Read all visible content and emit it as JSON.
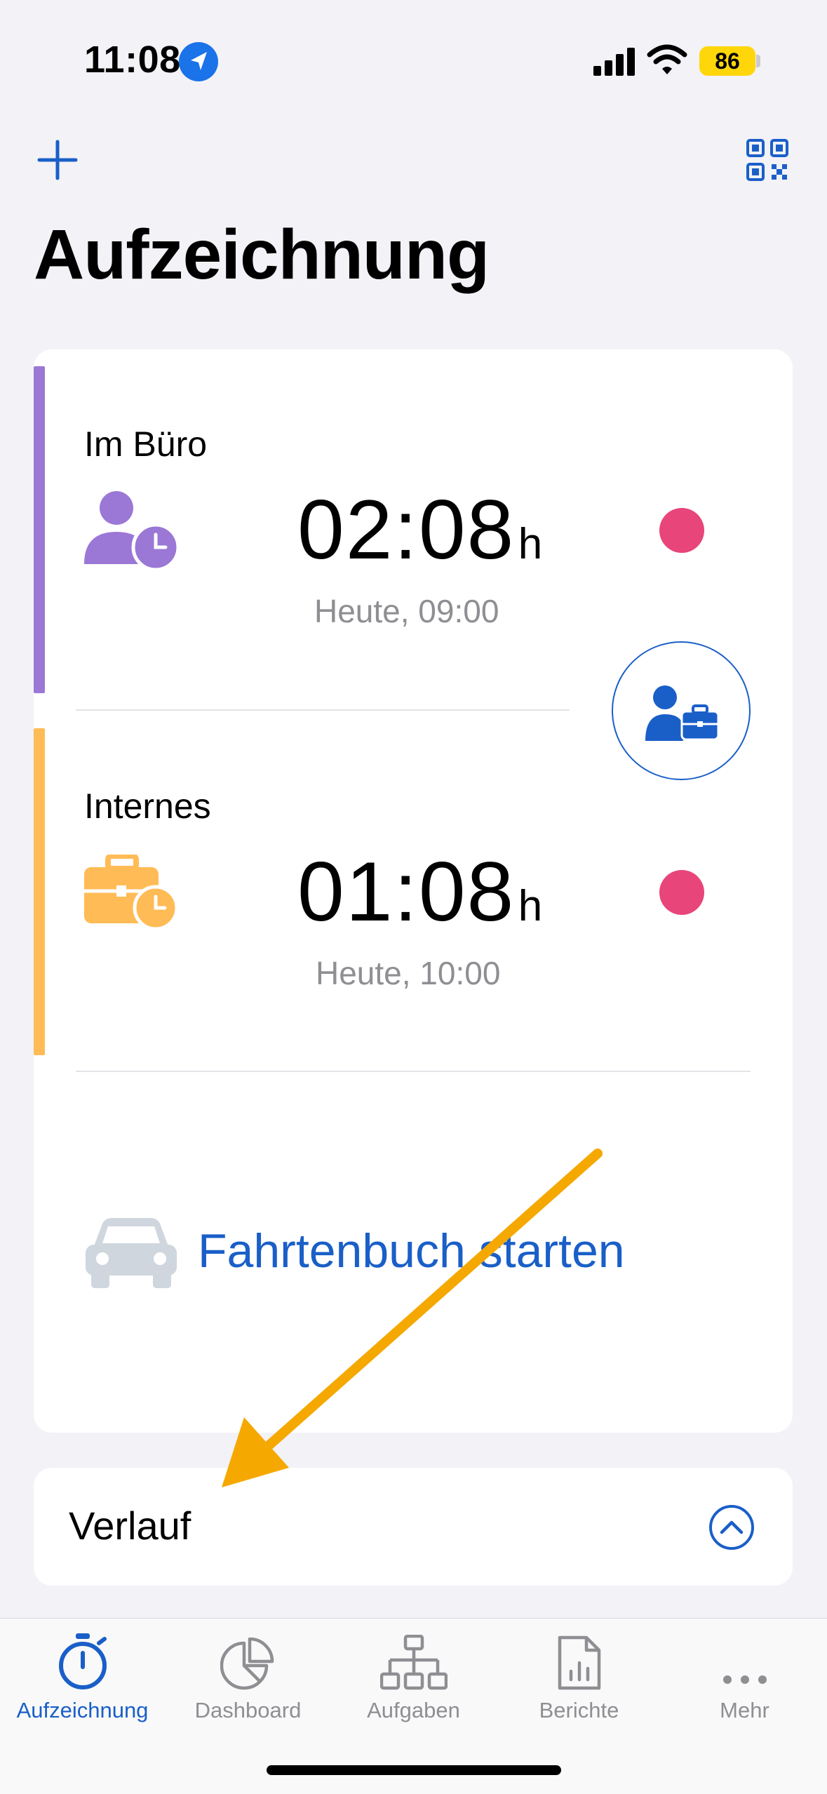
{
  "status_bar": {
    "time": "11:08",
    "battery": "86"
  },
  "header": {
    "title": "Aufzeichnung",
    "add_icon": "plus-icon",
    "qr_icon": "qr-code-icon"
  },
  "entries": [
    {
      "label": "Im Büro",
      "time": "02:08",
      "unit": "h",
      "subtitle": "Heute, 09:00",
      "accent": "#9b77d6",
      "icon": "person-clock-icon"
    },
    {
      "label": "Internes",
      "time": "01:08",
      "unit": "h",
      "subtitle": "Heute, 10:00",
      "accent": "#ffbb55",
      "icon": "briefcase-clock-icon"
    }
  ],
  "recording_color": "#e8457a",
  "switch_button_icon": "person-briefcase-icon",
  "logbook": {
    "label": "Fahrtenbuch starten",
    "icon": "car-icon"
  },
  "history": {
    "label": "Verlauf",
    "icon": "chevron-up-circle-icon"
  },
  "tabs": [
    {
      "label": "Aufzeichnung",
      "icon": "stopwatch-icon",
      "active": true
    },
    {
      "label": "Dashboard",
      "icon": "pie-chart-icon",
      "active": false
    },
    {
      "label": "Aufgaben",
      "icon": "hierarchy-icon",
      "active": false
    },
    {
      "label": "Berichte",
      "icon": "report-icon",
      "active": false
    },
    {
      "label": "Mehr",
      "icon": "more-icon",
      "active": false
    }
  ],
  "colors": {
    "accent": "#1a5fc8",
    "annotation_arrow": "#f5a800"
  }
}
